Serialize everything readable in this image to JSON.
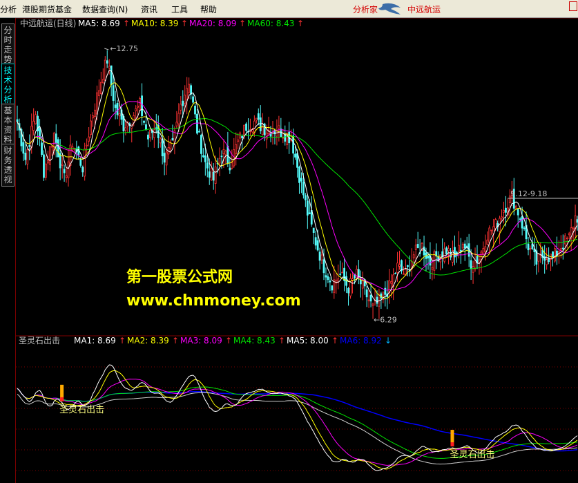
{
  "menu": {
    "items": [
      "分析",
      "港股期货基金",
      "数据查询(N)",
      "资讯",
      "工具",
      "帮助"
    ],
    "right_label": "分析家",
    "stock_name_menu": "中远航运"
  },
  "side_tabs": [
    {
      "label": "分时走势",
      "active": false
    },
    {
      "label": "技术分析",
      "active": true
    },
    {
      "label": "基本资料",
      "active": false
    },
    {
      "label": "财务透视",
      "active": false
    }
  ],
  "watermark": {
    "line1": "第一股票公式网",
    "line2": "www.chnmoney.com"
  },
  "colors": {
    "up": "#ff3232",
    "down": "#54fcfc",
    "ma5": "#ffffff",
    "ma10": "#ffff00",
    "ma20": "#ff00ff",
    "ma60": "#00e600",
    "ma6": "#0000ff",
    "grid": "#800000",
    "accent": "#ffff00"
  },
  "chart_data": [
    {
      "type": "candlestick",
      "title": "中远航运(日线)",
      "legend": [
        {
          "name": "MA5:",
          "value": "8.69",
          "arrow": "↑",
          "color": "#ffffff"
        },
        {
          "name": "MA10:",
          "value": "8.39",
          "arrow": "↑",
          "color": "#ffff00"
        },
        {
          "name": "MA20:",
          "value": "8.09",
          "arrow": "↑",
          "color": "#ff00ff"
        },
        {
          "name": "MA60:",
          "value": "8.43",
          "arrow": "↑",
          "color": "#00e600"
        }
      ],
      "annotations": [
        {
          "text": "12.75",
          "x_index": 44,
          "value": 12.75
        },
        {
          "text": "6.29",
          "x_index": 175,
          "value": 6.29
        },
        {
          "text": "9.12-9.18",
          "x_index": 240,
          "value": 9.15
        }
      ],
      "ylim": [
        6.0,
        13.3
      ],
      "price_path": [
        [
          0,
          11.0
        ],
        [
          4,
          10.1
        ],
        [
          9,
          11.2
        ],
        [
          13,
          9.8
        ],
        [
          18,
          10.7
        ],
        [
          23,
          9.6
        ],
        [
          27,
          10.5
        ],
        [
          32,
          9.9
        ],
        [
          36,
          11.0
        ],
        [
          41,
          12.0
        ],
        [
          44,
          12.5
        ],
        [
          48,
          11.3
        ],
        [
          52,
          10.9
        ],
        [
          56,
          11.1
        ],
        [
          60,
          11.4
        ],
        [
          64,
          10.6
        ],
        [
          68,
          10.9
        ],
        [
          72,
          10.1
        ],
        [
          76,
          10.4
        ],
        [
          80,
          11.4
        ],
        [
          84,
          12.0
        ],
        [
          88,
          10.8
        ],
        [
          92,
          10.0
        ],
        [
          96,
          9.6
        ],
        [
          100,
          10.3
        ],
        [
          104,
          10.0
        ],
        [
          108,
          10.5
        ],
        [
          112,
          10.9
        ],
        [
          116,
          11.0
        ],
        [
          122,
          10.8
        ],
        [
          128,
          10.8
        ],
        [
          134,
          10.6
        ],
        [
          138,
          9.7
        ],
        [
          142,
          8.8
        ],
        [
          146,
          8.1
        ],
        [
          150,
          7.5
        ],
        [
          154,
          7.1
        ],
        [
          158,
          7.3
        ],
        [
          162,
          7.0
        ],
        [
          166,
          7.3
        ],
        [
          170,
          6.9
        ],
        [
          174,
          6.5
        ],
        [
          178,
          6.7
        ],
        [
          182,
          7.0
        ],
        [
          186,
          7.5
        ],
        [
          190,
          7.3
        ],
        [
          194,
          7.8
        ],
        [
          198,
          8.0
        ],
        [
          202,
          7.6
        ],
        [
          206,
          7.8
        ],
        [
          210,
          7.9
        ],
        [
          214,
          7.7
        ],
        [
          218,
          8.1
        ],
        [
          222,
          7.6
        ],
        [
          226,
          7.7
        ],
        [
          230,
          8.3
        ],
        [
          234,
          8.5
        ],
        [
          238,
          8.9
        ],
        [
          242,
          9.2
        ],
        [
          246,
          8.7
        ],
        [
          250,
          8.0
        ],
        [
          254,
          7.6
        ],
        [
          258,
          7.8
        ],
        [
          262,
          7.7
        ],
        [
          266,
          8.0
        ],
        [
          270,
          8.2
        ],
        [
          273,
          8.7
        ]
      ]
    },
    {
      "type": "line",
      "title": "圣灵石出击",
      "legend": [
        {
          "name": "MA1:",
          "value": "8.69",
          "arrow": "↑",
          "color": "#ffffff"
        },
        {
          "name": "MA2:",
          "value": "8.39",
          "arrow": "↑",
          "color": "#ffff00"
        },
        {
          "name": "MA3:",
          "value": "8.09",
          "arrow": "↑",
          "color": "#ff00ff"
        },
        {
          "name": "MA4:",
          "value": "8.43",
          "arrow": "↑",
          "color": "#00e600"
        },
        {
          "name": "MA5:",
          "value": "8.00",
          "arrow": "↑",
          "color": "#ffffff"
        },
        {
          "name": "MA6:",
          "value": "8.92",
          "arrow": "↓",
          "color": "#0000ff"
        }
      ],
      "signals": [
        {
          "label": "圣灵石出击",
          "x_index": 22
        },
        {
          "label": "圣灵石出击",
          "x_index": 213
        }
      ]
    }
  ]
}
